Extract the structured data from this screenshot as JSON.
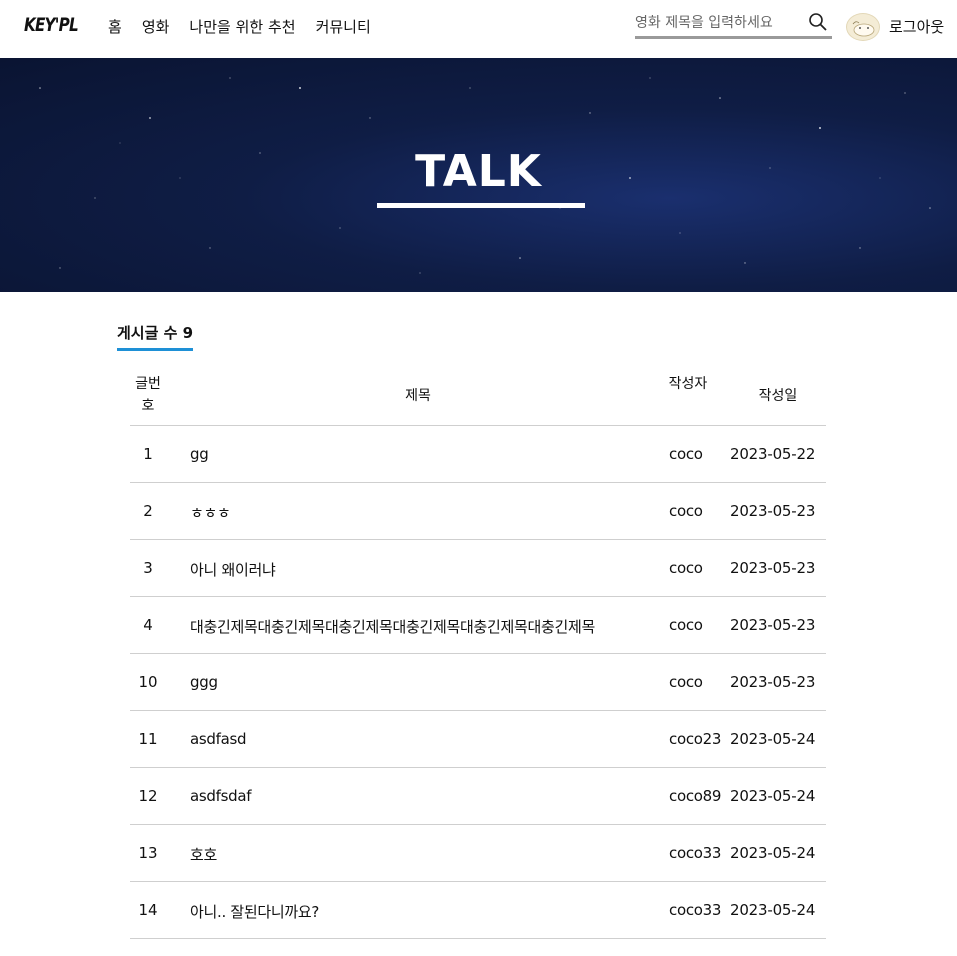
{
  "header": {
    "logo": "KEY'PL",
    "nav": [
      "홈",
      "영화",
      "나만을 위한 추천",
      "커뮤니티"
    ],
    "search_placeholder": "영화 제목을 입력하세요",
    "logout": "로그아웃"
  },
  "hero": {
    "title": "TALK"
  },
  "board": {
    "count_label": "게시글 수 9",
    "columns": {
      "no": "글번호",
      "title": "제목",
      "writer": "작성자",
      "date": "작성일"
    },
    "rows": [
      {
        "no": "1",
        "title": "gg",
        "writer": "coco",
        "date": "2023-05-22"
      },
      {
        "no": "2",
        "title": "ㅎㅎㅎ",
        "writer": "coco",
        "date": "2023-05-23"
      },
      {
        "no": "3",
        "title": "아니 왜이러냐",
        "writer": "coco",
        "date": "2023-05-23"
      },
      {
        "no": "4",
        "title": "대충긴제목대충긴제목대충긴제목대충긴제목대충긴제목대충긴제목",
        "writer": "coco",
        "date": "2023-05-23"
      },
      {
        "no": "10",
        "title": "ggg",
        "writer": "coco",
        "date": "2023-05-23"
      },
      {
        "no": "11",
        "title": "asdfasd",
        "writer": "coco23",
        "date": "2023-05-24"
      },
      {
        "no": "12",
        "title": "asdfsdaf",
        "writer": "coco89",
        "date": "2023-05-24"
      },
      {
        "no": "13",
        "title": "호호",
        "writer": "coco33",
        "date": "2023-05-24"
      },
      {
        "no": "14",
        "title": "아니.. 잘된다니까요?",
        "writer": "coco33",
        "date": "2023-05-24"
      }
    ]
  },
  "colors": {
    "accent": "#1e90d6",
    "hero_bg": "#0f1d45"
  }
}
